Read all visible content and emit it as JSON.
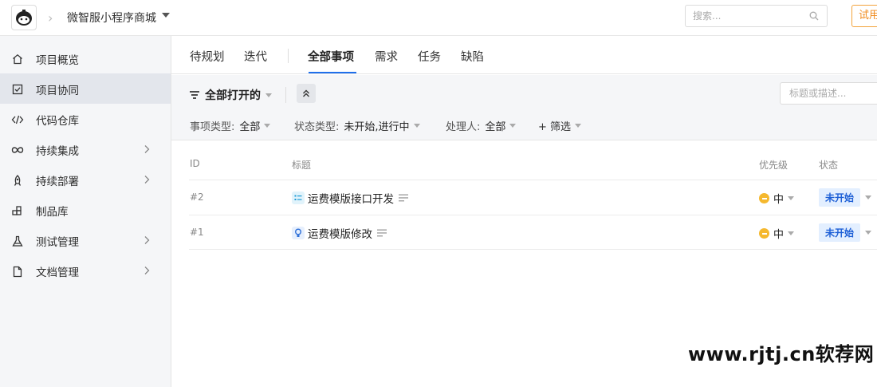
{
  "topbar": {
    "project_name": "微智服小程序商城",
    "search_placeholder": "搜索...",
    "trial_label": "试用"
  },
  "sidebar": {
    "items": [
      {
        "label": "项目概览",
        "icon": "home-icon",
        "has_children": false,
        "active": false
      },
      {
        "label": "项目协同",
        "icon": "checkbox-icon",
        "has_children": false,
        "active": true
      },
      {
        "label": "代码仓库",
        "icon": "code-icon",
        "has_children": false,
        "active": false
      },
      {
        "label": "持续集成",
        "icon": "infinity-icon",
        "has_children": true,
        "active": false
      },
      {
        "label": "持续部署",
        "icon": "rocket-icon",
        "has_children": true,
        "active": false
      },
      {
        "label": "制品库",
        "icon": "artifact-icon",
        "has_children": false,
        "active": false
      },
      {
        "label": "测试管理",
        "icon": "flask-icon",
        "has_children": true,
        "active": false
      },
      {
        "label": "文档管理",
        "icon": "document-icon",
        "has_children": true,
        "active": false
      }
    ]
  },
  "tabs": {
    "items": [
      "待规划",
      "迭代",
      "全部事项",
      "需求",
      "任务",
      "缺陷"
    ],
    "active": "全部事项"
  },
  "filters": {
    "view_title": "全部打开的",
    "desc_search_placeholder": "标题或描述...",
    "issue_type_label": "事项类型:",
    "issue_type_value": "全部",
    "status_type_label": "状态类型:",
    "status_type_value": "未开始,进行中",
    "assignee_label": "处理人:",
    "assignee_value": "全部",
    "more_filter_label": "+ 筛选"
  },
  "table": {
    "columns": {
      "id": "ID",
      "title": "标题",
      "priority": "优先级",
      "status": "状态"
    },
    "rows": [
      {
        "id": "#2",
        "title": "运费模版接口开发",
        "type": "task",
        "priority": "中",
        "status": "未开始"
      },
      {
        "id": "#1",
        "title": "运费模版修改",
        "type": "requirement",
        "priority": "中",
        "status": "未开始"
      }
    ]
  },
  "colors": {
    "accent": "#1f6feb",
    "priority_medium": "#f5b82e",
    "status_bg": "#e3efff",
    "trial_orange": "#f08a1c"
  },
  "watermark": "www.rjtj.cn软荐网"
}
